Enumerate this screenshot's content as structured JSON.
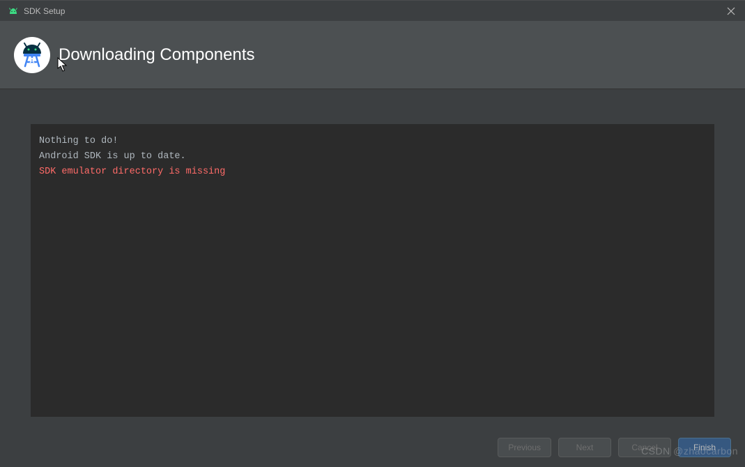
{
  "window": {
    "title": "SDK Setup"
  },
  "header": {
    "title": "Downloading Components"
  },
  "console": {
    "lines": [
      {
        "text": "Nothing to do!",
        "type": "normal"
      },
      {
        "text": "Android SDK is up to date.",
        "type": "normal"
      },
      {
        "text": "SDK emulator directory is missing",
        "type": "error"
      }
    ]
  },
  "footer": {
    "previous": "Previous",
    "next": "Next",
    "cancel": "Cancel",
    "finish": "Finish"
  },
  "watermark": "CSDN @zhaocarbon"
}
